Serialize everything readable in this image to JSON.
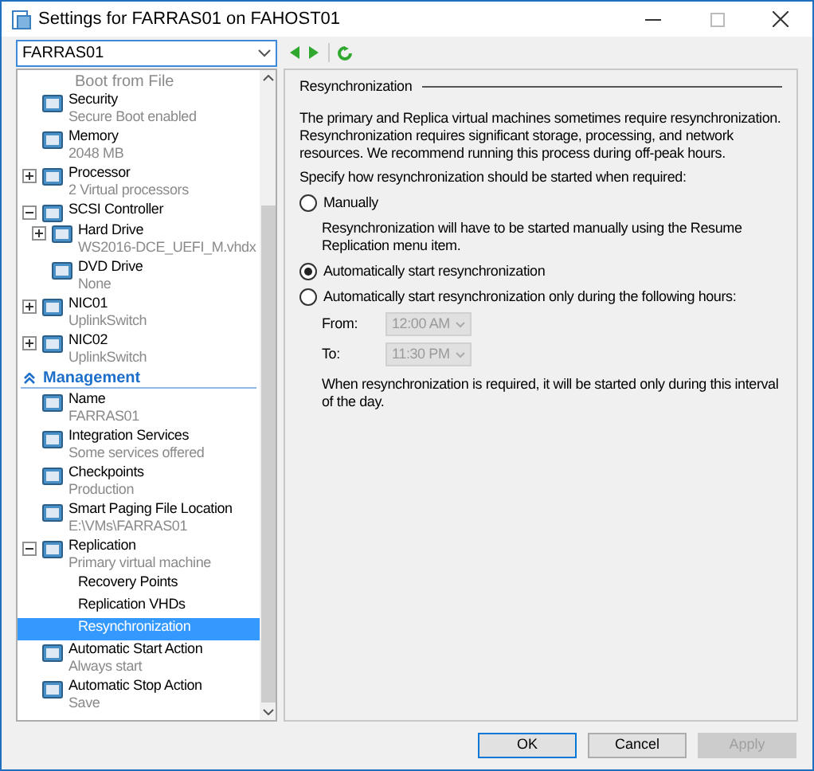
{
  "window": {
    "title": "Settings for FARRAS01 on FAHOST01"
  },
  "vm_select": {
    "value": "FARRAS01"
  },
  "tree": {
    "hardware": [
      {
        "kind": "partial",
        "detail": "Boot from File",
        "selected": false
      },
      {
        "kind": "item",
        "name": "Security",
        "detail": "Secure Boot enabled",
        "selected": false
      },
      {
        "kind": "item",
        "name": "Memory",
        "detail": "2048 MB",
        "selected": false
      },
      {
        "kind": "item",
        "name": "Processor",
        "detail": "2 Virtual processors",
        "expanded": false,
        "selected": false
      },
      {
        "kind": "item",
        "name": "SCSI Controller",
        "expanded": true,
        "selected": false,
        "children": [
          {
            "kind": "item",
            "name": "Hard Drive",
            "detail": "WS2016-DCE_UEFI_M.vhdx",
            "expanded": false,
            "selected": false
          },
          {
            "kind": "item",
            "name": "DVD Drive",
            "detail": "None",
            "selected": false
          }
        ]
      },
      {
        "kind": "item",
        "name": "NIC01",
        "detail": "UplinkSwitch",
        "expanded": false,
        "selected": false
      },
      {
        "kind": "item",
        "name": "NIC02",
        "detail": "UplinkSwitch",
        "expanded": false,
        "selected": false
      }
    ],
    "management_label": "Management",
    "management": [
      {
        "kind": "item",
        "name": "Name",
        "detail": "FARRAS01",
        "selected": false
      },
      {
        "kind": "item",
        "name": "Integration Services",
        "detail": "Some services offered",
        "selected": false
      },
      {
        "kind": "item",
        "name": "Checkpoints",
        "detail": "Production",
        "selected": false
      },
      {
        "kind": "item",
        "name": "Smart Paging File Location",
        "detail": "E:\\VMs\\FARRAS01",
        "selected": false
      },
      {
        "kind": "item",
        "name": "Replication",
        "detail": "Primary virtual machine",
        "expanded": true,
        "selected": false,
        "children": [
          {
            "kind": "sub",
            "name": "Recovery Points",
            "selected": false
          },
          {
            "kind": "sub",
            "name": "Replication VHDs",
            "selected": false
          },
          {
            "kind": "sub",
            "name": "Resynchronization",
            "selected": true
          }
        ]
      },
      {
        "kind": "item",
        "name": "Automatic Start Action",
        "detail": "Always start",
        "selected": false
      },
      {
        "kind": "item",
        "name": "Automatic Stop Action",
        "detail": "Save",
        "selected": false
      }
    ]
  },
  "panel": {
    "title": "Resynchronization",
    "intro": "The primary and Replica virtual machines sometimes require resynchronization. Resynchronization requires significant storage, processing, and network resources. We recommend running this process during off-peak hours.",
    "prompt": "Specify how resynchronization should be started when required:",
    "options": [
      {
        "label": "Manually",
        "selected": false,
        "note": "Resynchronization will have to be started manually using the Resume Replication menu item."
      },
      {
        "label": "Automatically start resynchronization",
        "selected": true
      },
      {
        "label": "Automatically start resynchronization only during the following hours:",
        "selected": false
      }
    ],
    "times": [
      {
        "label": "From:",
        "value": "12:00 AM",
        "disabled": true
      },
      {
        "label": "To:",
        "value": "11:30 PM",
        "disabled": true
      }
    ],
    "footnote": "When resynchronization is required, it will be started only during this interval of the day."
  },
  "buttons": [
    {
      "label": "OK",
      "disabled": false,
      "default": true
    },
    {
      "label": "Cancel",
      "disabled": false,
      "default": false
    },
    {
      "label": "Apply",
      "disabled": true,
      "default": false
    }
  ]
}
